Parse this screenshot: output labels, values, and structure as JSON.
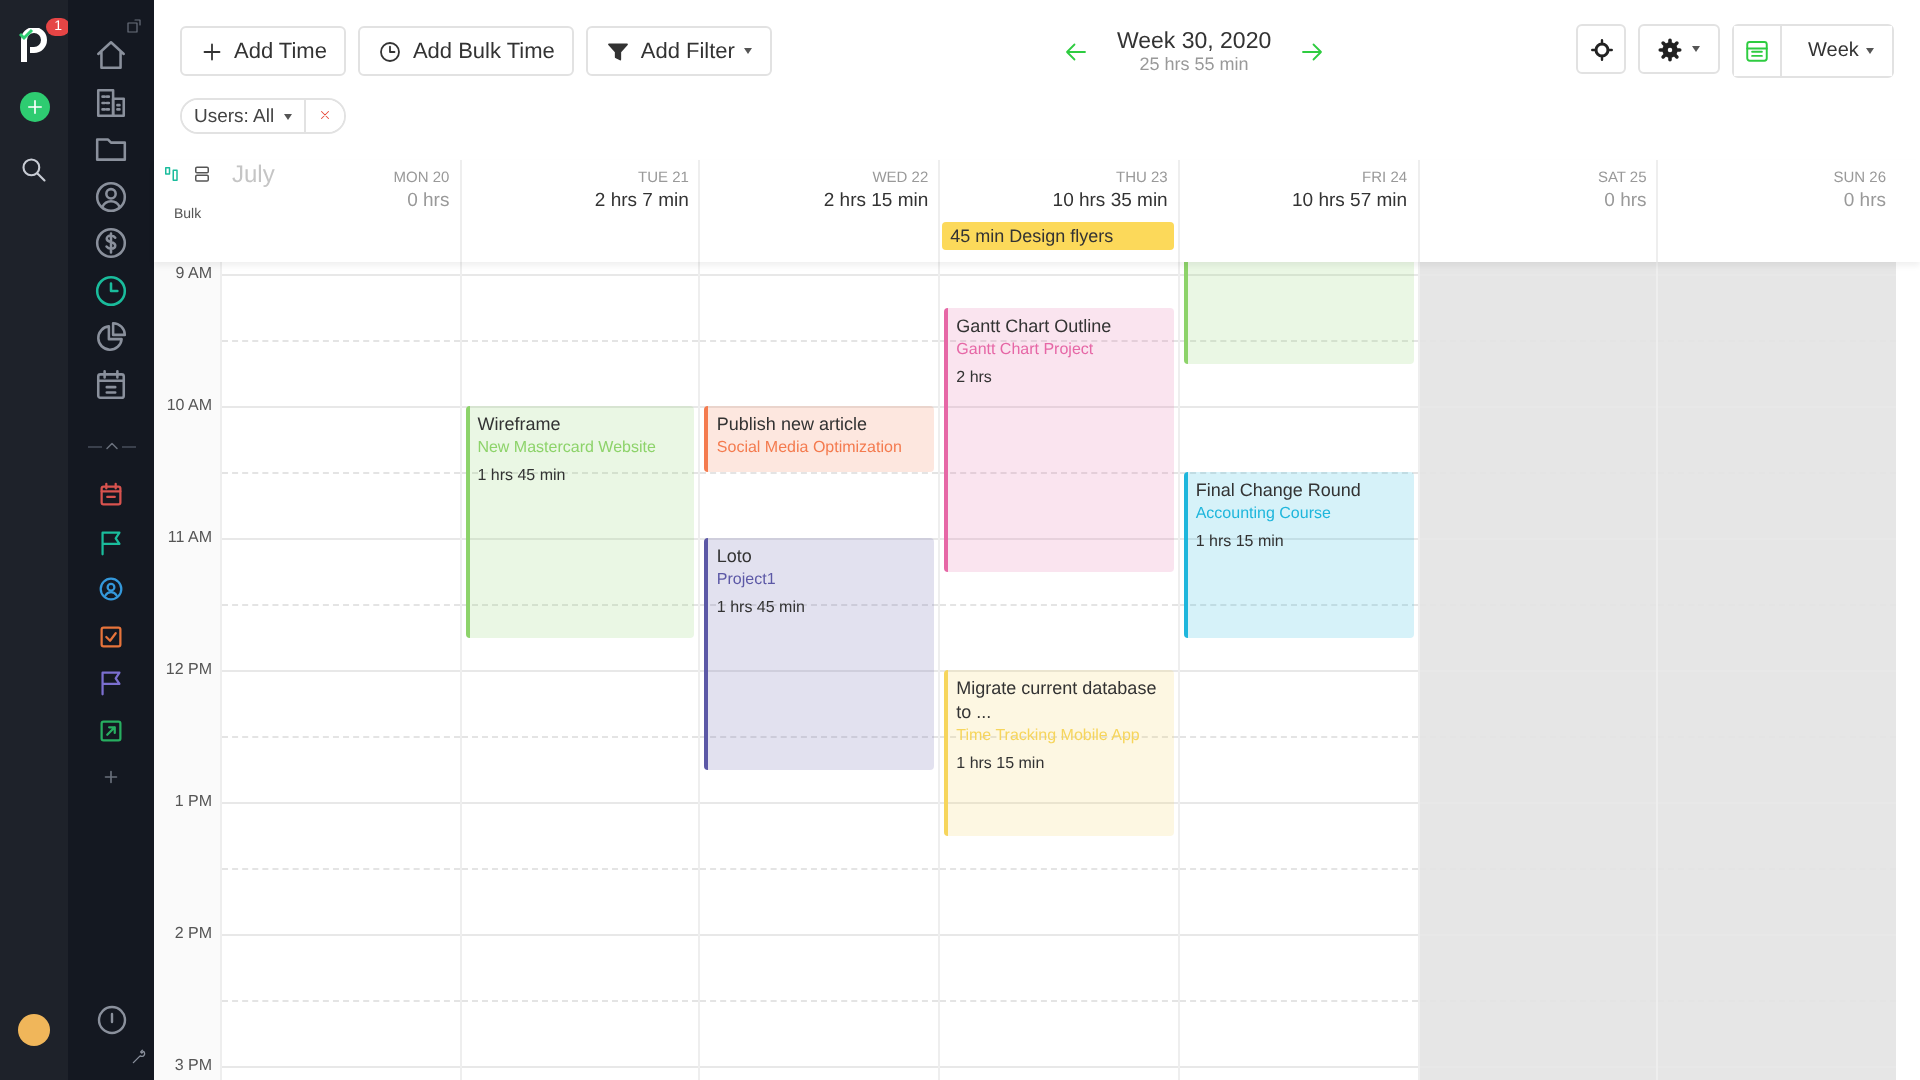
{
  "sidebar": {
    "notification_count": "1",
    "nav_items": [
      {
        "selected": false
      },
      {
        "selected": false
      },
      {
        "selected": false
      },
      {
        "selected": false
      },
      {
        "selected": false
      },
      {
        "selected": true
      },
      {
        "selected": false
      },
      {
        "selected": false
      }
    ],
    "project_items": [
      {
        "color": "#d9534f"
      },
      {
        "color": "#1abc9c"
      },
      {
        "color": "#3498db"
      },
      {
        "color": "#e8743b"
      },
      {
        "color": "#7b6fd0"
      },
      {
        "color": "#27ae60"
      }
    ]
  },
  "toolbar": {
    "buttons": [
      "Add Time",
      "Add Bulk Time",
      "Add Filter"
    ],
    "week_title": "Week 30, 2020",
    "week_total": "25 hrs 55 min",
    "view": "Week"
  },
  "filter_chip": {
    "label": "Users: All"
  },
  "calendar": {
    "month": "July",
    "bulk_label": "Bulk",
    "hours": [
      "9 AM",
      "10 AM",
      "11 AM",
      "12 PM",
      "1 PM",
      "2 PM",
      "3 PM"
    ],
    "days": [
      {
        "label": "MON 20",
        "total": "0 hrs",
        "logged": false,
        "weekend": false
      },
      {
        "label": "TUE 21",
        "total": "2 hrs 7 min",
        "logged": true,
        "weekend": false,
        "entries": [
          {
            "title": "Wireframe",
            "project": "New Mastercard Website",
            "duration": "1 hrs 45 min",
            "color": "#8dd36a"
          }
        ]
      },
      {
        "label": "WED 22",
        "total": "2 hrs 15 min",
        "logged": true,
        "weekend": false,
        "entries": [
          {
            "title": "Publish new article",
            "project": "Social Media Optimization",
            "color": "#f47b4f"
          },
          {
            "title": "Loto",
            "project": "Project1",
            "duration": "1 hrs 45 min",
            "color": "#5c58a6"
          }
        ]
      },
      {
        "label": "THU 23",
        "total": "10 hrs 35 min",
        "logged": true,
        "weekend": false,
        "all_day": [
          "45 min Design flyers"
        ],
        "entries": [
          {
            "title": "Gantt Chart Outline",
            "project": "Gantt Chart Project",
            "duration": "2 hrs",
            "color": "#e667a6"
          },
          {
            "title": "Migrate current database to ...",
            "project": "Time Tracking Mobile App",
            "duration": "1 hrs 15 min",
            "color": "#f6d55c"
          }
        ]
      },
      {
        "label": "FRI 24",
        "total": "10 hrs 57 min",
        "logged": true,
        "weekend": false,
        "entries": [
          {
            "color": "#8dd36a"
          },
          {
            "title": "Final Change Round",
            "project": "Accounting Course",
            "duration": "1 hrs 15 min",
            "color": "#1eb6dc"
          }
        ]
      },
      {
        "label": "SAT 25",
        "total": "0 hrs",
        "logged": false,
        "weekend": true
      },
      {
        "label": "SUN 26",
        "total": "0 hrs",
        "logged": false,
        "weekend": true
      }
    ]
  }
}
